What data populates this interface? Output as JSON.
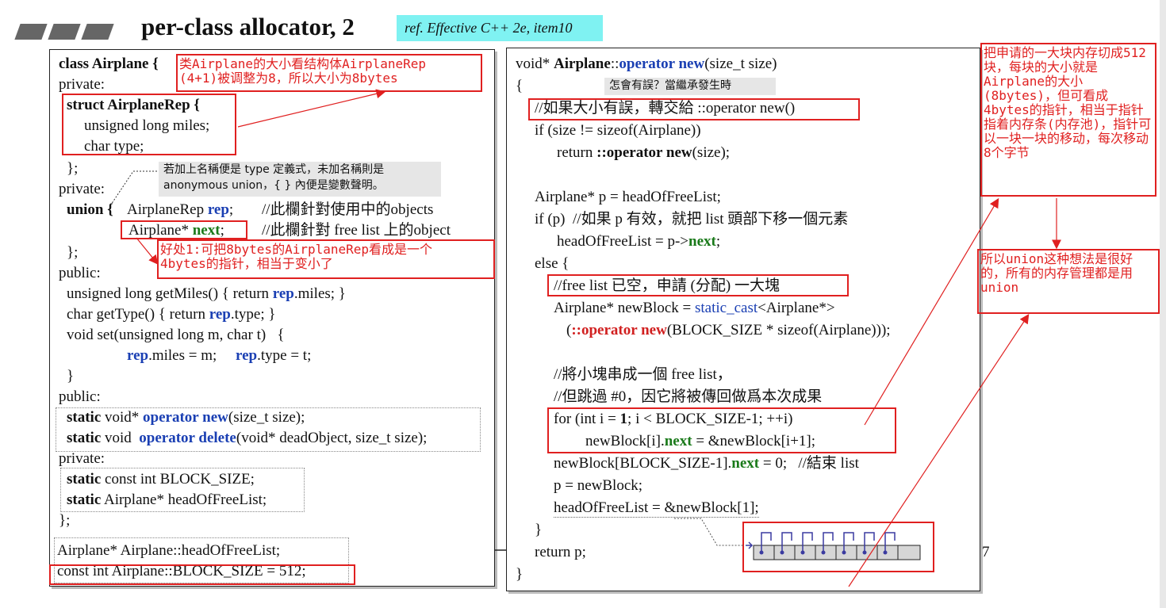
{
  "slide": {
    "title": "per-class allocator, 2",
    "ref": "ref. Effective C++ 2e, item10",
    "page_number": "7"
  },
  "left_code": [
    "class Airplane {",
    "private:",
    "struct AirplaneRep {",
    "unsigned long miles;",
    "char type;",
    "};",
    "private:",
    "union {",
    "AirplaneRep rep;",
    "//此欄針對使用中的objects",
    "Airplane* next;",
    "//此欄針對 free list 上的object",
    "};",
    "public:",
    "unsigned long getMiles() { return ",
    "rep",
    ".miles; }",
    "char getType() { return ",
    "rep",
    ".type; }",
    "void set(unsigned long m, char t)   {",
    "rep",
    ".miles = m;",
    "rep",
    ".type = t;",
    "}",
    "public:",
    "static",
    " void* ",
    "operator new",
    "(size_t size);",
    "static",
    " void  ",
    "operator delete",
    "(void* deadObject, size_t size);",
    "private:",
    "static",
    " const int BLOCK_SIZE;",
    "static",
    " Airplane* headOfFreeList;",
    "};",
    "Airplane* Airplane::headOfFreeList;",
    "const int Airplane::BLOCK_SIZE = 512;"
  ],
  "right_code": [
    "void* ",
    "Airplane",
    "::",
    "operator new",
    "(size_t size)",
    "{",
    "//如果大小有誤，轉交給 ::operator new()",
    "if (size != sizeof(Airplane))",
    "return ",
    "::operator new",
    "(size);",
    "Airplane* p = headOfFreeList;",
    "if (p)  //如果 p 有效，就把 list 頭部下移一個元素",
    "headOfFreeList = p->",
    "next",
    ";",
    "else {",
    "//free list 已空，申請 (分配) 一大塊",
    "Airplane* newBlock = ",
    "static_cast",
    "<Airplane*>",
    "(",
    "::operator new",
    "(BLOCK_SIZE * sizeof(Airplane)));",
    "//將小塊串成一個 free list，",
    "//但跳過 #0，因它將被傳回做爲本次成果",
    "for (int i = ",
    "1",
    "; i < BLOCK_SIZE-1; ++i)",
    "newBlock[i].",
    "next",
    " = &newBlock[i+1];",
    "newBlock[BLOCK_SIZE-1].",
    "next",
    " = 0;   //結束 list",
    "p = newBlock;",
    "headOfFreeList = &newBlock[1];",
    "}",
    "return p;",
    "}"
  ],
  "callouts": {
    "type_def": "若加上名稱便是 type 定義式，未加名稱則是",
    "type_def2": "anonymous union，{ } 內便是變數聲明。",
    "inherit": "怎會有誤？當繼承發生時"
  },
  "notes": {
    "size_note": "类Airplane的大小看结构体AirplaneRep\n(4+1)被调整为8，所以大小为8bytes",
    "benefit_note": "好处1:可把8bytes的AirplaneRep看成是一个\n4bytes的指针，相当于变小了",
    "cut_note": "把申请的一大块内存切成512块，每块的大小就是Airplane的大小(8bytes)，但可看成4bytes的指针，相当于指针指着内存条(内存池)，指针可以一块一块的移动，每次移动8个字节",
    "union_note": "所以union这种想法是很好的，所有的内存管理都是用union"
  },
  "colors": {
    "keyword_blue": "#1a3fb3",
    "member_green": "#1a7a1a",
    "annotation_red": "#e02020",
    "ref_cyan": "#7ff2f2"
  }
}
